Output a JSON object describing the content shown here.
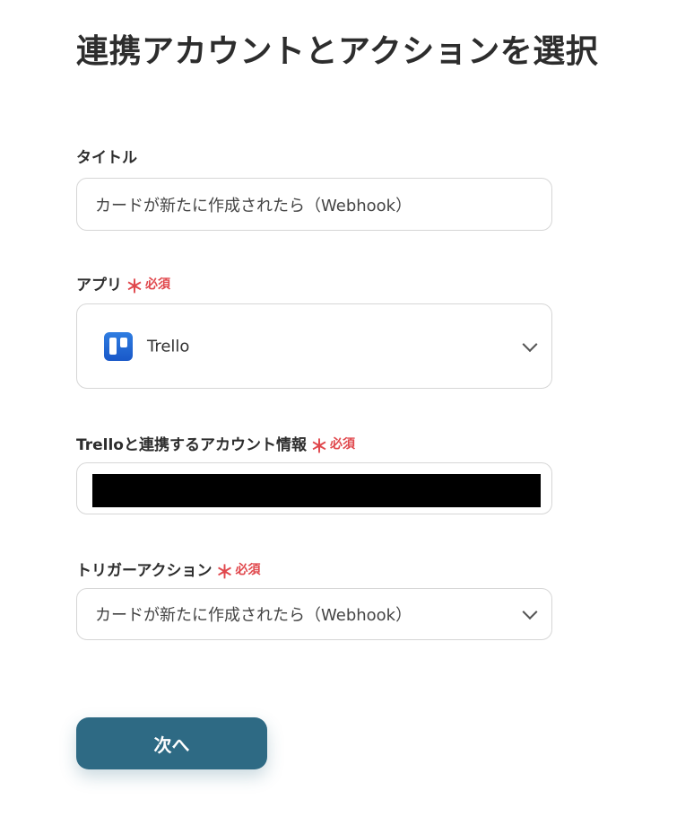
{
  "page": {
    "title": "連携アカウントとアクションを選択"
  },
  "form": {
    "required_mark": "＊",
    "required_text": "必須",
    "title_field": {
      "label": "タイトル",
      "value": "カードが新たに作成されたら（Webhook）"
    },
    "app_field": {
      "label": "アプリ",
      "value": "Trello",
      "icon": "trello-logo"
    },
    "account_field": {
      "label": "Trelloと連携するアカウント情報"
    },
    "trigger_field": {
      "label": "トリガーアクション",
      "value": "カードが新たに作成されたら（Webhook）"
    }
  },
  "actions": {
    "next_label": "次へ"
  },
  "colors": {
    "primary_button": "#2e6a84",
    "required": "#e0474c",
    "trello_blue": "#1958c8"
  }
}
